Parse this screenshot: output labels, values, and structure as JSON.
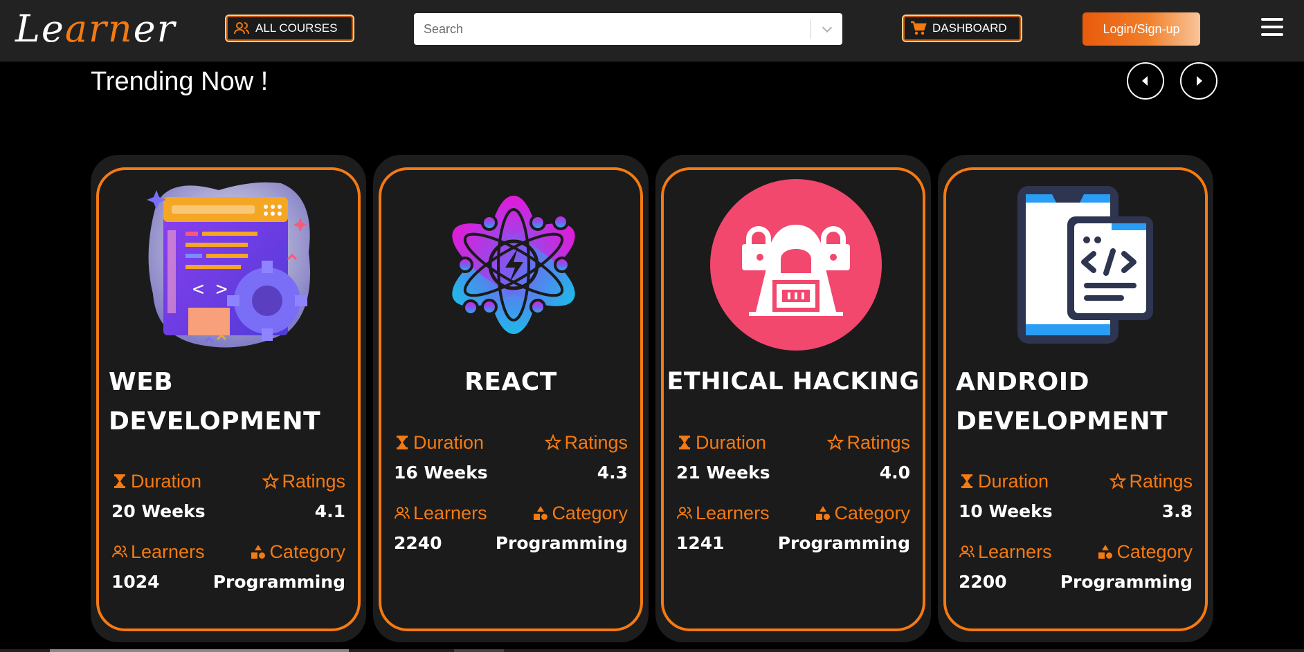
{
  "brand": {
    "logo_part1": "Le",
    "logo_part2": "arn",
    "logo_part3": "er"
  },
  "nav": {
    "all_courses_label": "ALL COURSES",
    "search_placeholder": "Search",
    "dashboard_label": "DASHBOARD",
    "login_label": "Login/Sign-up",
    "menu_icon": "hamburger-icon"
  },
  "section": {
    "title": "Trending Now !"
  },
  "labels": {
    "duration": "Duration",
    "ratings": "Ratings",
    "learners": "Learners",
    "category": "Category"
  },
  "colors": {
    "accent": "#f47a12",
    "navbar": "#222222",
    "card": "#1b1b1b",
    "background": "#000000"
  },
  "courses": [
    {
      "title": "WEB DEVELOPMENT",
      "duration": "20 Weeks",
      "rating": "4.1",
      "learners": "1024",
      "category": "Programming",
      "image": "web-development-illustration"
    },
    {
      "title": "REACT",
      "duration": "16 Weeks",
      "rating": "4.3",
      "learners": "2240",
      "category": "Programming",
      "image": "react-atom-icon"
    },
    {
      "title": "ETHICAL HACKING",
      "duration": "21 Weeks",
      "rating": "4.0",
      "learners": "1241",
      "category": "Programming",
      "image": "hacker-icon"
    },
    {
      "title": "ANDROID DEVELOPMENT",
      "duration": "10 Weeks",
      "rating": "3.8",
      "learners": "2200",
      "category": "Programming",
      "image": "android-code-icon"
    }
  ]
}
